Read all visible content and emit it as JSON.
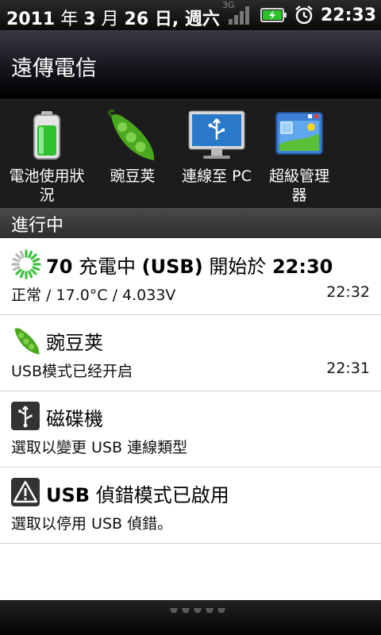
{
  "status_bar": {
    "date_year": "2011",
    "date_sep1": " 年 ",
    "date_month": "3",
    "date_sep2": " 月 ",
    "date_day": "26",
    "date_sep3": " 日, 週六",
    "network_label": "3G",
    "time": "22:33",
    "icons": [
      "usb-debug-icon",
      "signal-icon",
      "battery-charging-icon",
      "alarm-clock-icon"
    ]
  },
  "carrier": "遠傳電信",
  "quick_actions": [
    {
      "label": "電池使用狀\n況",
      "icon": "battery-icon"
    },
    {
      "label": "豌豆荚",
      "icon": "pea-pod-icon"
    },
    {
      "label": "連線至 PC",
      "icon": "monitor-usb-icon"
    },
    {
      "label": "超級管理器",
      "icon": "window-manager-icon"
    }
  ],
  "section_title": "進行中",
  "notifications": [
    {
      "title_num": "70",
      "title_rest": " 充電中 ",
      "title_usb": "(USB)",
      "title_mid": " 開始於 ",
      "title_time": "22:30",
      "subtitle": "正常 / 17.0°C / 4.033V",
      "time": "22:32",
      "icon": "charging-ring-icon"
    },
    {
      "title": "豌豆荚",
      "subtitle": "USB模式已经开启",
      "time": "22:31",
      "icon": "pea-pod-icon"
    },
    {
      "title": "磁碟機",
      "subtitle": "選取以變更 USB 連線類型",
      "time": "",
      "icon": "usb-icon"
    },
    {
      "title_bold": "USB",
      "title_rest": " 偵錯模式已啟用",
      "subtitle": "選取以停用 USB 偵錯。",
      "time": "",
      "icon": "warning-icon"
    }
  ],
  "colors": {
    "battery_green": "#2fc22f",
    "pea_green": "#4aa81e",
    "list_background": "#ffffff",
    "section_header": "#3a3a3a"
  }
}
